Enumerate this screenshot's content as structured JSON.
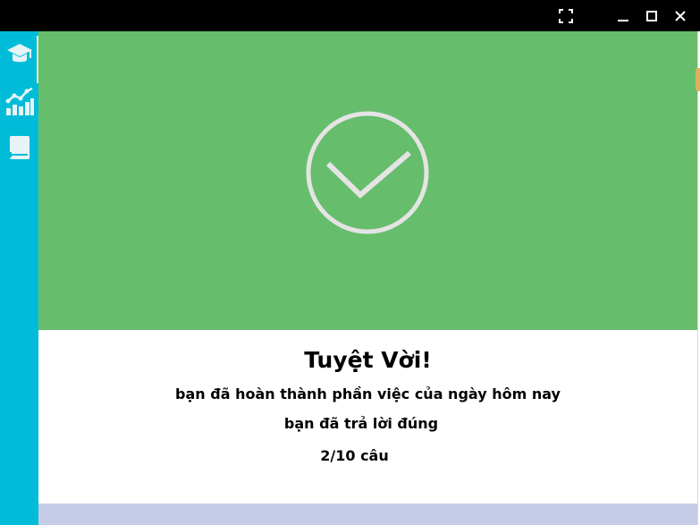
{
  "window": {
    "controls": {
      "fullscreen_icon": "fullscreen-icon",
      "minimize_icon": "minimize-icon",
      "maximize_icon": "maximize-icon",
      "close_icon": "close-icon"
    }
  },
  "sidebar": {
    "items": [
      {
        "icon": "graduation-cap-icon",
        "active": true
      },
      {
        "icon": "statistics-chart-icon",
        "active": false
      },
      {
        "icon": "book-icon",
        "active": false
      }
    ],
    "background": "#00bcd8"
  },
  "result": {
    "title": "Tuyệt Vời!",
    "line1": "bạn đã hoàn thành phần việc của ngày hôm nay",
    "line2": "bạn đã trả lời đúng",
    "count": "2/10 câu",
    "hero_color": "#66bd6c",
    "check_icon": "check-circle-icon"
  }
}
